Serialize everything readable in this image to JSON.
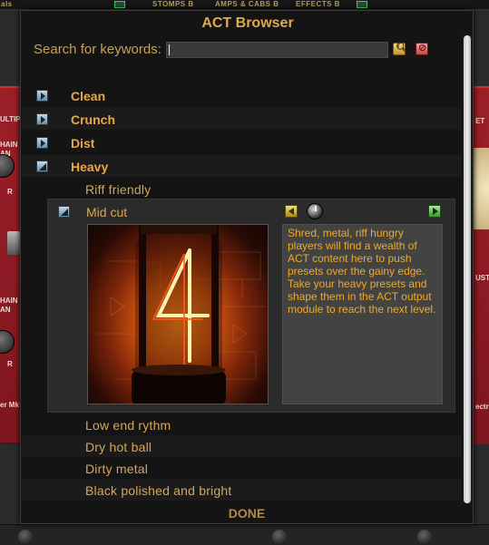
{
  "host": {
    "topbar_labels": [
      "als",
      "STOMPS B",
      "AMPS & CABS B",
      "EFFECTS B"
    ],
    "left_rack_text": [
      "ULTIP",
      "HAIN",
      "AN",
      "R",
      "HAIN",
      "AN",
      "R",
      "er Mk"
    ],
    "right_rack_text": [
      "ET",
      "UST",
      "ectr"
    ]
  },
  "dialog": {
    "title": "ACT Browser",
    "search": {
      "label": "Search for keywords:",
      "value": "",
      "search_icon": "magnifier-icon",
      "clear_icon": "clear-icon"
    },
    "categories": [
      {
        "label": "Clean",
        "expanded": false
      },
      {
        "label": "Crunch",
        "expanded": false
      },
      {
        "label": "Dist",
        "expanded": false
      },
      {
        "label": "Heavy",
        "expanded": true
      }
    ],
    "presets_before": [
      "Riff friendly"
    ],
    "selected_preset": {
      "name": "Mid cut",
      "image": "nixie-tube-number-4",
      "description": "Shred, metal, riff hungry players will find a wealth of ACT content here to push presets over the gainy edge. Take your heavy presets and shape them in the ACT output module to reach the next level."
    },
    "presets_after": [
      "Low end rythm",
      "Dry hot ball",
      "Dirty metal",
      "Black polished and bright"
    ],
    "done_label": "DONE",
    "colors": {
      "accent": "#e0a94a",
      "description_text": "#f0a928",
      "background": "#141414"
    }
  }
}
